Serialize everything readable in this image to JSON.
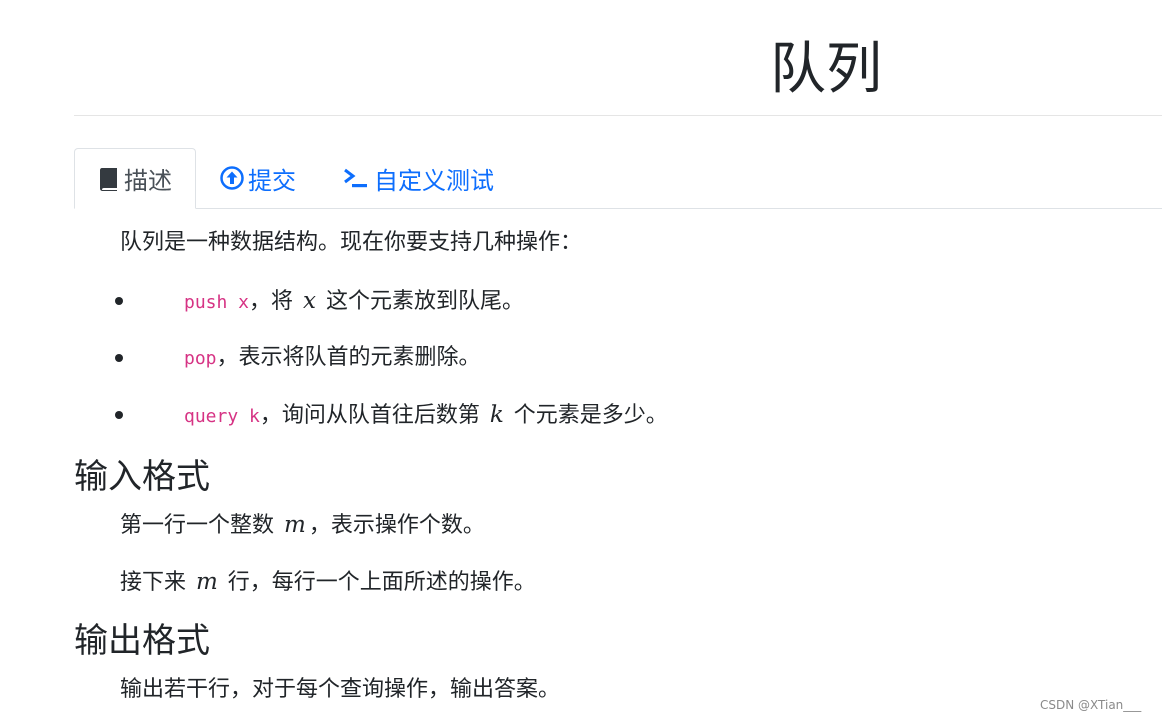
{
  "page": {
    "title": "队列"
  },
  "tabs": [
    {
      "label": "描述",
      "icon": "book-icon",
      "active": true
    },
    {
      "label": "提交",
      "icon": "upload-circle-icon",
      "active": false
    },
    {
      "label": "自定义测试",
      "icon": "terminal-icon",
      "active": false
    }
  ],
  "description": {
    "intro": "队列是一种数据结构。现在你要支持几种操作：",
    "ops": [
      {
        "code": "push x",
        "pre": "，将 ",
        "var": "x",
        "post": " 这个元素放到队尾。"
      },
      {
        "code": "pop",
        "pre": "，表示将队首的元素删除。",
        "var": "",
        "post": ""
      },
      {
        "code": "query k",
        "pre": "，询问从队首往后数第 ",
        "var": "k",
        "post": " 个元素是多少。"
      }
    ]
  },
  "input_section": {
    "heading": "输入格式",
    "line1_pre": "第一行一个整数 ",
    "line1_var": "m",
    "line1_post": "，表示操作个数。",
    "line2_pre": "接下来 ",
    "line2_var": "m",
    "line2_post": " 行，每行一个上面所述的操作。"
  },
  "output_section": {
    "heading": "输出格式",
    "line1": "输出若干行，对于每个查询操作，输出答案。"
  },
  "watermark": "CSDN @XTian___",
  "colors": {
    "link": "#0d6efd",
    "code": "#d63384",
    "text": "#212529"
  }
}
